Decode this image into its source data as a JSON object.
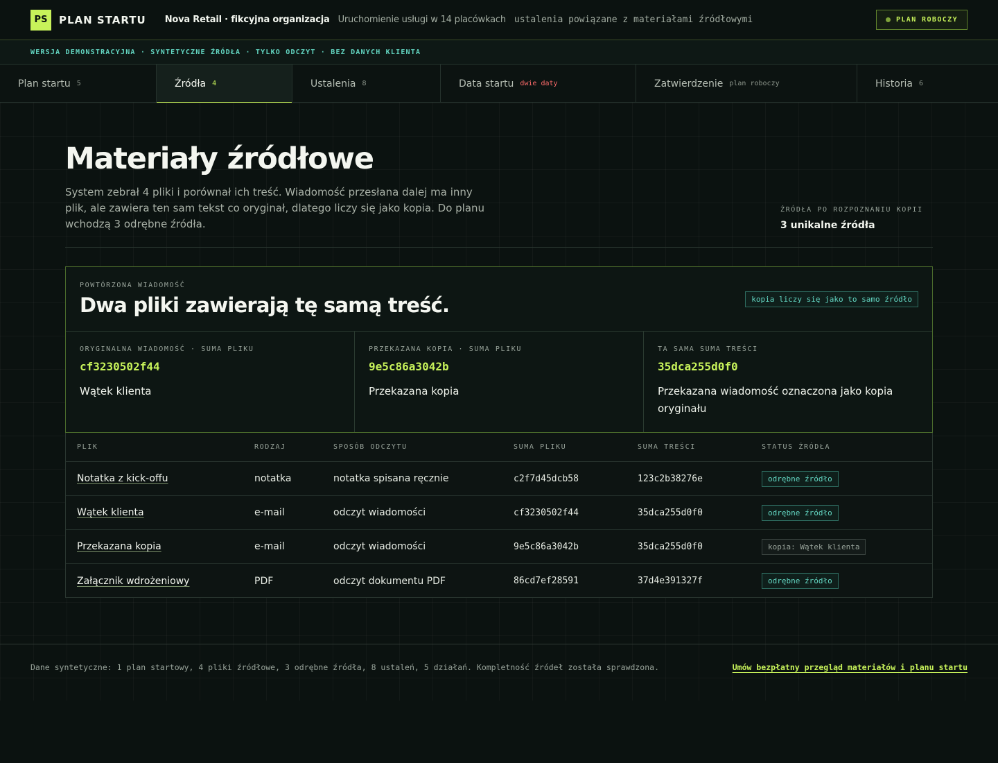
{
  "header": {
    "logo": "PS",
    "brand": "PLAN STARTU",
    "org": "Nova Retail · fikcyjna organizacja",
    "org_sub": "Uruchomienie usługi w 14 placówkach",
    "org_mono": "ustalenia powiązane z materiałami źródłowymi",
    "status": "PLAN ROBOCZY"
  },
  "strip": "WERSJA DEMONSTRACYJNA · SYNTETYCZNE ŹRÓDŁA · TYLKO ODCZYT · BEZ DANYCH KLIENTA",
  "tabs": [
    {
      "label": "Plan startu",
      "count": "5"
    },
    {
      "label": "Źródła",
      "count": "4"
    },
    {
      "label": "Ustalenia",
      "count": "8"
    },
    {
      "label": "Data startu",
      "count": "dwie daty"
    },
    {
      "label": "Zatwierdzenie",
      "count": "plan roboczy"
    },
    {
      "label": "Historia",
      "count": "6"
    }
  ],
  "page": {
    "title": "Materiały źródłowe",
    "lead": "System zebrał 4 pliki i porównał ich treść. Wiadomość przesłana dalej ma inny plik, ale zawiera ten sam tekst co oryginał, dlatego liczy się jako kopia. Do planu wchodzą 3 odrębne źródła.",
    "side_label": "ŹRÓDŁA PO ROZPOZNANIU KOPII",
    "side_value": "3 unikalne źródła"
  },
  "duplicate": {
    "label": "POWTÓRZONA WIADOMOŚĆ",
    "title": "Dwa pliki zawierają tę samą treść.",
    "badge": "kopia liczy się jako to samo źródło",
    "cols": [
      {
        "label": "ORYGINALNA WIADOMOŚĆ · SUMA PLIKU",
        "hash": "cf3230502f44",
        "text": "Wątek klienta"
      },
      {
        "label": "PRZEKAZANA KOPIA · SUMA PLIKU",
        "hash": "9e5c86a3042b",
        "text": "Przekazana kopia"
      },
      {
        "label": "TA SAMA SUMA TREŚCI",
        "hash": "35dca255d0f0",
        "text": "Przekazana wiadomość oznaczona jako kopia oryginału"
      }
    ]
  },
  "table": {
    "headers": [
      "PLIK",
      "RODZAJ",
      "SPOSÓB ODCZYTU",
      "SUMA PLIKU",
      "SUMA TREŚCI",
      "STATUS ŹRÓDŁA"
    ],
    "rows": [
      {
        "file": "Notatka z kick-offu",
        "kind": "notatka",
        "method": "notatka spisana ręcznie",
        "file_hash": "c2f7d45dcb58",
        "content_hash": "123c2b38276e",
        "status": "odrębne źródło"
      },
      {
        "file": "Wątek klienta",
        "kind": "e-mail",
        "method": "odczyt wiadomości",
        "file_hash": "cf3230502f44",
        "content_hash": "35dca255d0f0",
        "status": "odrębne źródło"
      },
      {
        "file": "Przekazana kopia",
        "kind": "e-mail",
        "method": "odczyt wiadomości",
        "file_hash": "9e5c86a3042b",
        "content_hash": "35dca255d0f0",
        "status": "kopia: Wątek klienta"
      },
      {
        "file": "Załącznik wdrożeniowy",
        "kind": "PDF",
        "method": "odczyt dokumentu PDF",
        "file_hash": "86cd7ef28591",
        "content_hash": "37d4e391327f",
        "status": "odrębne źródło"
      }
    ]
  },
  "footer": {
    "text": "Dane syntetyczne: 1 plan startowy, 4 pliki źródłowe, 3 odrębne źródła, 8 ustaleń, 5 działań. Kompletność źródeł została sprawdzona.",
    "link": "Umów bezpłatny przegląd materiałów i planu startu"
  },
  "colors": {
    "accent": "#c7f25a",
    "teal": "#63d6c2",
    "warn": "#ff6b6b",
    "bg": "#0b1210"
  }
}
